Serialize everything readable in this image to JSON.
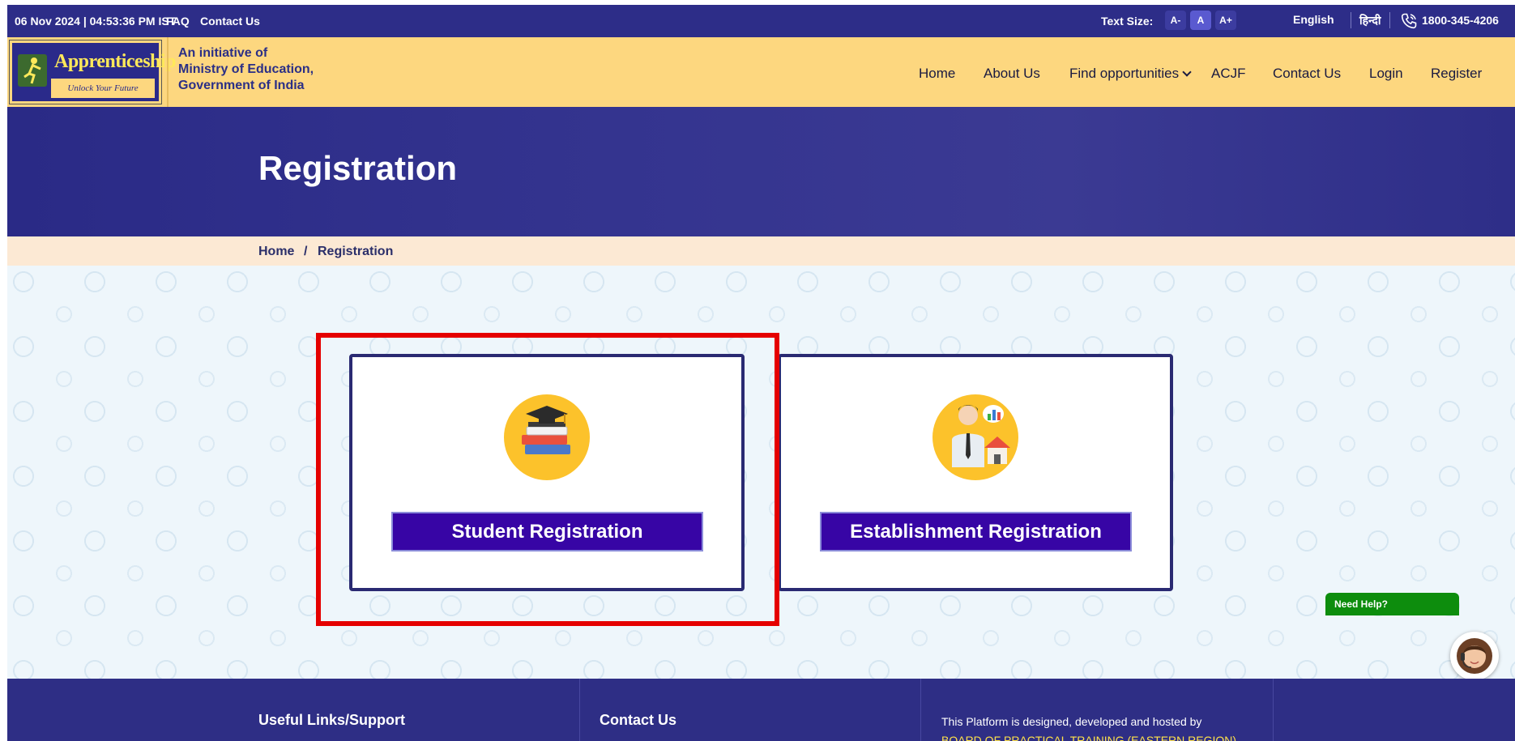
{
  "topbar": {
    "datetime": "06 Nov 2024 | 04:53:36 PM IST",
    "faq": "FAQ",
    "contact": "Contact Us",
    "text_size_label": "Text Size:",
    "text_size_options": [
      "A-",
      "A",
      "A+"
    ],
    "lang_english": "English",
    "lang_hindi": "हिन्दी",
    "phone": "1800-345-4206"
  },
  "header": {
    "logo_title": "Apprenticeship",
    "logo_tagline": "Unlock Your Future",
    "initiative_line1": "An initiative of",
    "initiative_line2": "Ministry of Education,",
    "initiative_line3": "Government of India",
    "nav": {
      "home": "Home",
      "about": "About Us",
      "find": "Find opportunities",
      "acjf": "ACJF",
      "contact": "Contact Us",
      "login": "Login",
      "register": "Register"
    }
  },
  "hero": {
    "title": "Registration"
  },
  "breadcrumb": {
    "home": "Home",
    "separator": "/",
    "current": "Registration"
  },
  "cards": {
    "student": {
      "label": "Student Registration",
      "icon": "graduation-books-icon"
    },
    "establishment": {
      "label": "Establishment Registration",
      "icon": "business-person-icon"
    }
  },
  "help": {
    "label": "Need Help?"
  },
  "footer": {
    "useful_links": "Useful Links/Support",
    "contact": "Contact Us",
    "platform_text": "This Platform is designed, developed and hosted by",
    "board_link": "BOARD OF PRACTICAL TRAINING (EASTERN REGION),"
  },
  "colors": {
    "primary": "#2d2d88",
    "header_bg": "#fdd77f",
    "button": "#3705a5",
    "highlight": "#e50000",
    "help": "#0d8d0d"
  }
}
